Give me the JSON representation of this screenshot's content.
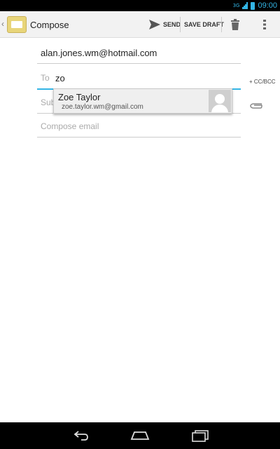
{
  "status_bar": {
    "network": "3G",
    "time": "09:00",
    "accent_color": "#33b5e5"
  },
  "action_bar": {
    "title": "Compose",
    "send_label": "SEND",
    "save_draft_label": "SAVE DRAFT",
    "icons": [
      "email-app-icon",
      "send-icon",
      "trash-icon",
      "overflow-menu-icon"
    ]
  },
  "compose": {
    "from": "alan.jones.wm@hotmail.com",
    "to_label": "To",
    "to_value": "zo",
    "subject_placeholder": "Sub",
    "body_placeholder": "Compose email",
    "cc_bcc_label": "+ CC/BCC"
  },
  "autocomplete": {
    "name": "Zoe Taylor",
    "email": "zoe.taylor.wm@gmail.com"
  },
  "nav_bar": {
    "icons": [
      "back-icon",
      "home-icon",
      "recents-icon"
    ]
  }
}
